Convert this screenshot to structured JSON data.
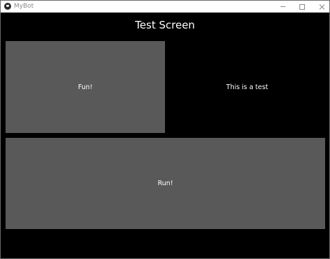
{
  "window": {
    "title": "MyBot",
    "icon": "app-logo-icon",
    "controls": [
      "minimize-icon",
      "maximize-icon",
      "close-icon"
    ]
  },
  "screen": {
    "title": "Test Screen",
    "fun_button_label": "Fun!",
    "test_label": "This is a test",
    "run_button_label": "Run!"
  },
  "colors": {
    "background": "#000000",
    "button": "#595959",
    "text": "#ffffff"
  }
}
